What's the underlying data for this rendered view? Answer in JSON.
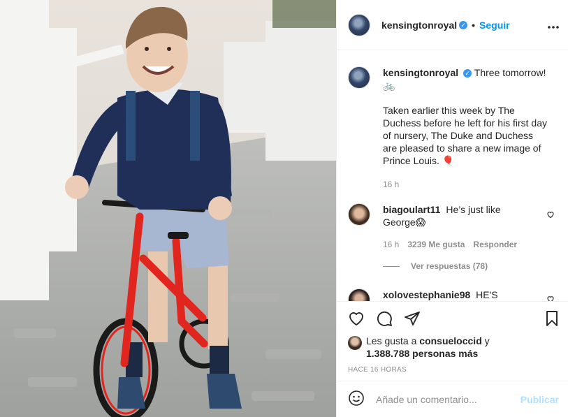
{
  "header": {
    "username": "kensingtonroyal",
    "verified_mark": "✓",
    "separator": "•",
    "follow_label": "Seguir",
    "more_icon": "more-horizontal-icon"
  },
  "caption": {
    "username": "kensingtonroyal",
    "line1": "Three tomorrow!",
    "emoji1": "🚲",
    "paragraph": "Taken earlier this week by The Duchess before he left for his first day of nursery, The Duke and Duchess are pleased to share a new image of Prince Louis.",
    "emoji2": "🎈",
    "time": "16 h"
  },
  "comments": [
    {
      "username": "biagoulart11",
      "text": "He’s just like George",
      "emoji": "😱",
      "time": "16 h",
      "likes": "3239 Me gusta",
      "reply_label": "Responder",
      "view_replies": "Ver respuestas (78)"
    },
    {
      "username": "xolovestephanie98",
      "text": "HE'S"
    }
  ],
  "actions": {
    "like_icon": "heart-icon",
    "comment_icon": "comment-icon",
    "share_icon": "paper-plane-icon",
    "save_icon": "bookmark-icon"
  },
  "likes": {
    "prefix": "Les gusta a",
    "user": "consueloccid",
    "conj": "y",
    "count": "1.388.788 personas más"
  },
  "timestamp": "HACE 16 HORAS",
  "add_comment": {
    "placeholder": "Añade un comentario...",
    "publish_label": "Publicar",
    "emoji_icon": "smiley-icon"
  },
  "colors": {
    "accent": "#0095f6",
    "publish_disabled": "#b2dffc",
    "muted": "#8e8e8e",
    "border": "#efefef",
    "bike_red": "#e0261f"
  }
}
